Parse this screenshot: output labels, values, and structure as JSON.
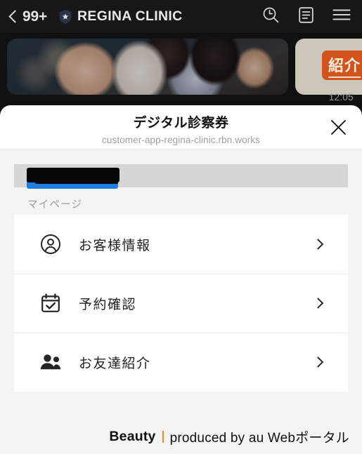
{
  "chat": {
    "back_count": "99+",
    "account_name": "REGINA CLINIC",
    "badge_icon": "verified-shield-icon",
    "search_icon": "search-clock-icon",
    "notes_icon": "notes-document-icon",
    "menu_icon": "hamburger-menu-icon",
    "message_time": "12:05",
    "promo_button_label": "紹介"
  },
  "modal": {
    "title": "デジタル診察券",
    "url": "customer-app-regina-clinic.rbn.works",
    "close_icon": "close-x-icon"
  },
  "page": {
    "id_bar_redacted": "",
    "section_label": "マイページ",
    "menu_items": [
      {
        "label": "お客様情報",
        "icon": "person-circle-icon",
        "chevron": "chevron-right-icon"
      },
      {
        "label": "予約確認",
        "icon": "calendar-check-icon",
        "chevron": "chevron-right-icon"
      },
      {
        "label": "お友達紹介",
        "icon": "people-group-icon",
        "chevron": "chevron-right-icon"
      }
    ]
  },
  "footer": {
    "brand": "Beauty",
    "produced_by": "produced by au Webポータル",
    "divider_color": "#f08a1e"
  }
}
